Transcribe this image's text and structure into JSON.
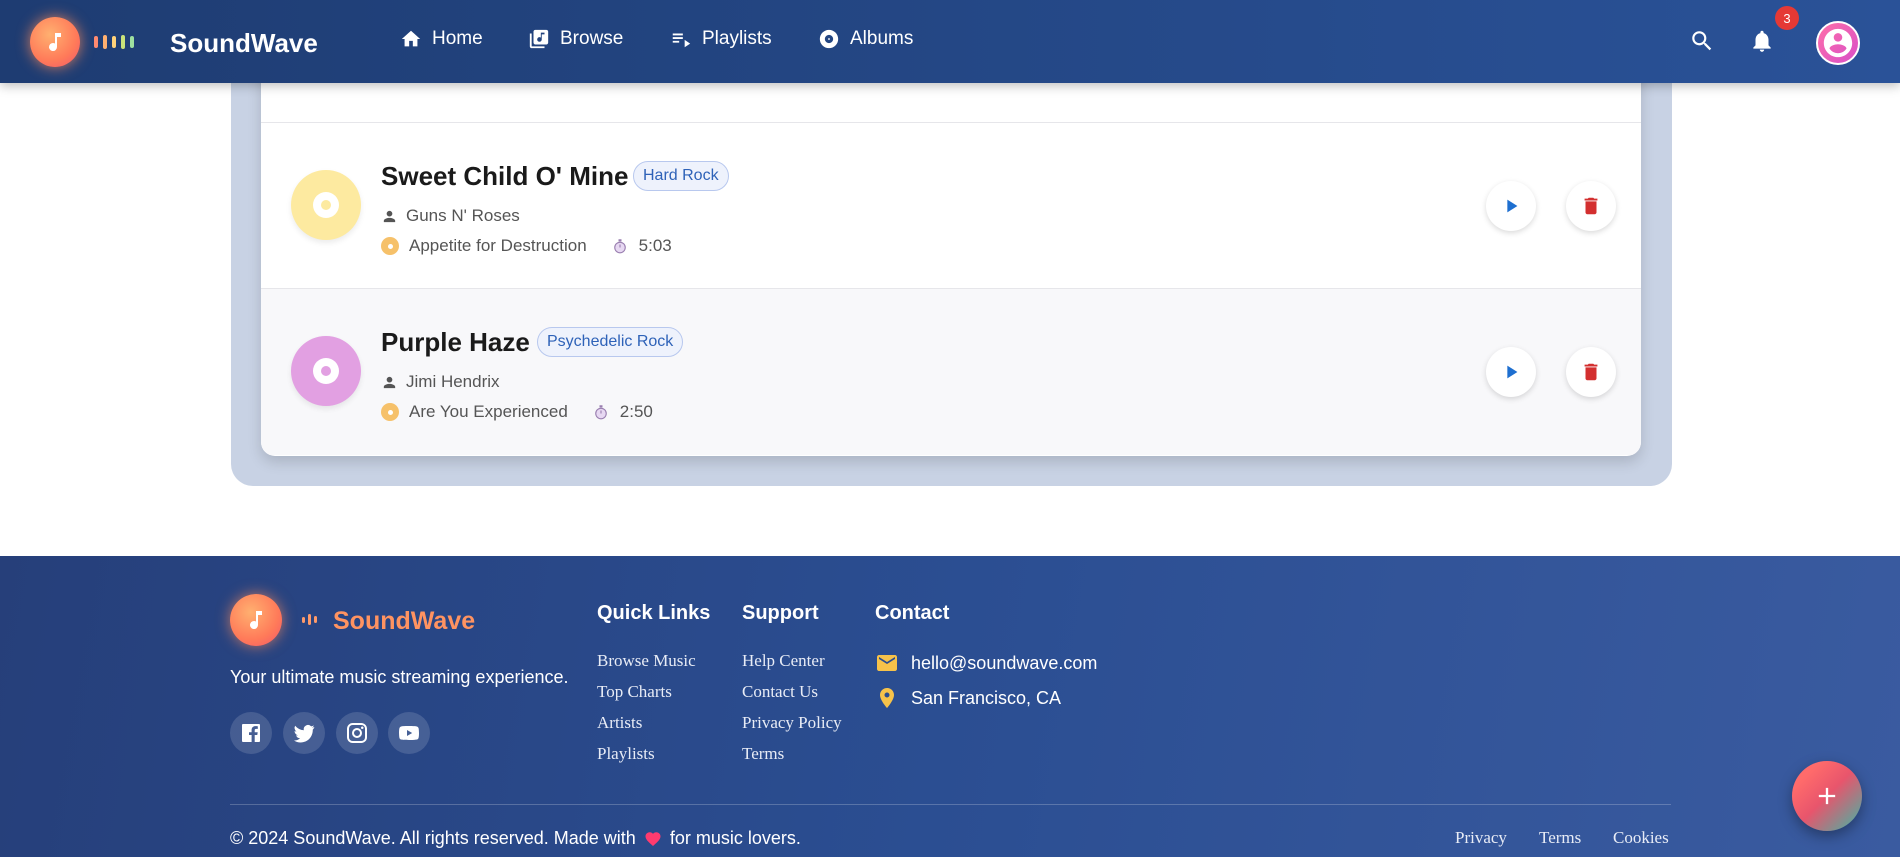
{
  "header": {
    "brand": "SoundWave",
    "nav": [
      {
        "label": "Home",
        "icon": "home-icon"
      },
      {
        "label": "Browse",
        "icon": "library-music-icon"
      },
      {
        "label": "Playlists",
        "icon": "playlist-play-icon"
      },
      {
        "label": "Albums",
        "icon": "album-icon"
      }
    ],
    "notification_count": "3"
  },
  "songs": [
    {
      "title": "Sweet Child O' Mine",
      "genre": "Hard Rock",
      "artist": "Guns N' Roses",
      "album": "Appetite for Destruction",
      "duration": "5:03",
      "disc_color": "#fdeaa0"
    },
    {
      "title": "Purple Haze",
      "genre": "Psychedelic Rock",
      "artist": "Jimi Hendrix",
      "album": "Are You Experienced",
      "duration": "2:50",
      "disc_color": "#e2a0e2"
    }
  ],
  "footer": {
    "brand": "SoundWave",
    "tagline": "Your ultimate music streaming experience.",
    "quick_links": {
      "title": "Quick Links",
      "items": [
        "Browse Music",
        "Top Charts",
        "Artists",
        "Playlists"
      ]
    },
    "support": {
      "title": "Support",
      "items": [
        "Help Center",
        "Contact Us",
        "Privacy Policy",
        "Terms"
      ]
    },
    "contact": {
      "title": "Contact",
      "email": "hello@soundwave.com",
      "location": "San Francisco, CA"
    },
    "copyright_prefix": "© 2024 SoundWave. All rights reserved. Made with",
    "copyright_suffix": "for music lovers.",
    "bottom_links": [
      "Privacy",
      "Terms",
      "Cookies"
    ],
    "social": [
      "facebook-icon",
      "twitter-icon",
      "instagram-icon",
      "youtube-icon"
    ]
  },
  "colors": {
    "header_start": "#1e3c72",
    "header_end": "#2a5298",
    "accent_orange": "#ff9361",
    "play_blue": "#1e6fd0",
    "delete_red": "#d32f2f"
  }
}
